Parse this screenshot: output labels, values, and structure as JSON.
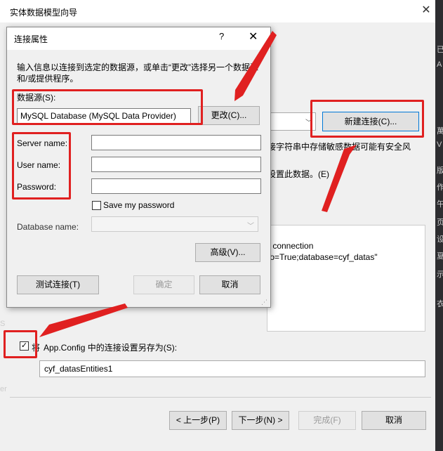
{
  "wizard": {
    "title": "实体数据模型向导",
    "close_glyph": "✕",
    "new_connection_button": "新建连接(C)...",
    "sensitive_text": "接字符串中存储敏感数据可能有安全风",
    "settings_text": "设置此数据。(E)",
    "conn_line1": "r connection",
    "conn_line2": "fo=True;database=cyf_datas\"",
    "save_prefix": "将",
    "save_label": "App.Config 中的连接设置另存为(S):",
    "entities_name": "cyf_datasEntities1",
    "prev_button": "< 上一步(P)",
    "next_button": "下一步(N) >",
    "finish_button": "完成(F)",
    "cancel_button": "取消",
    "checkbox_checked": "☑"
  },
  "dialog": {
    "title": "连接属性",
    "help_glyph": "?",
    "close_glyph": "✕",
    "intro_line1": "输入信息以连接到选定的数据源，或单击“更改”选择另一个数据源",
    "intro_line2": "和/或提供程序。",
    "datasource_label": "数据源(S):",
    "datasource_value": "MySQL Database (MySQL Data Provider)",
    "change_button": "更改(C)...",
    "server_label": "Server name:",
    "user_label": "User name:",
    "password_label": "Password:",
    "save_password_label": "Save my password",
    "database_label": "Database name:",
    "advanced_button": "高级(V)...",
    "test_button": "测试连接(T)",
    "ok_button": "确定",
    "cancel_button": "取消"
  },
  "side_strip_chars": [
    "已",
    "A",
    "萬",
    "V",
    "版",
    "作",
    "午",
    "页",
    "设",
    "夏",
    "示",
    "衣",
    "S",
    "er"
  ],
  "colors": {
    "annotation_red": "#e02020",
    "focus_blue": "#0078d7"
  }
}
